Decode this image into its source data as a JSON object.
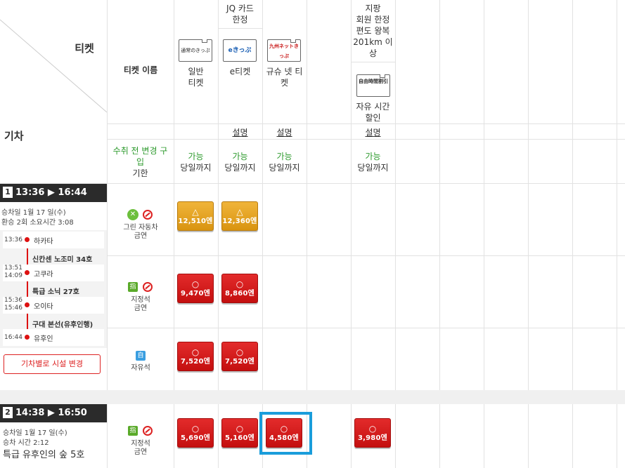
{
  "header": {
    "ticket_label": "티켓",
    "train_label": "기차",
    "ticket_name_label": "티켓 이름",
    "change_limit": {
      "line1": "수취 전 변경 구",
      "line2": "입",
      "line3": "기한"
    },
    "jq_card_limited": {
      "line1": "JQ 카드",
      "line2": "한정"
    },
    "local_member": {
      "line1": "지팡",
      "line2": "회원 한정",
      "line3": "편도 왕복",
      "line4": "201km 이",
      "line5": "상"
    }
  },
  "tickets": [
    {
      "logo": "通常のきっぷ",
      "name1": "일반",
      "name2": "티켓",
      "explain": "",
      "available": "가능",
      "until": "당일까지"
    },
    {
      "logo": "eきっぷ",
      "name1": "e티켓",
      "name2": "",
      "explain": "설명",
      "available": "가능",
      "until": "당일까지"
    },
    {
      "logo": "九州ネットきっぷ",
      "name1": "규슈 넷 티",
      "name2": "켓",
      "explain": "설명",
      "available": "가능",
      "until": "당일까지"
    },
    {
      "logo": "自由時間割引",
      "name1": "자유 시간",
      "name2": "할인",
      "explain": "설명",
      "available": "가능",
      "until": "당일까지"
    }
  ],
  "train1": {
    "num": "1",
    "time": "13:36 ▶ 16:44",
    "date": "승차일 1월 17 일(수)",
    "transfer": "환승 2회  소요시간 3:08",
    "stops": [
      {
        "time": "13:36",
        "name": "하카타"
      },
      {
        "time": "13:51",
        "time2": "14:09",
        "name": "고쿠라"
      },
      {
        "time": "15:36",
        "time2": "15:46",
        "name": "오이타"
      },
      {
        "time": "16:44",
        "name": "유후인"
      }
    ],
    "segments": [
      "신칸센 노조미 34호",
      "특급 소닉 27호",
      "구대 본선(유후인행)"
    ],
    "change_btn": "기차별로 시설 변경",
    "rows": [
      {
        "seat": "그린 자동차",
        "seat2": "금연",
        "prices": [
          {
            "mark": "△",
            "amt": "12,510엔"
          },
          {
            "mark": "△",
            "amt": "12,360엔"
          }
        ]
      },
      {
        "seat": "지정석",
        "seat2": "금연",
        "prices": [
          {
            "mark": "○",
            "amt": "9,470엔"
          },
          {
            "mark": "○",
            "amt": "8,860엔"
          }
        ]
      },
      {
        "seat": "자유석",
        "seat2": "",
        "prices": [
          {
            "mark": "○",
            "amt": "7,520엔"
          },
          {
            "mark": "○",
            "amt": "7,520엔"
          }
        ]
      }
    ]
  },
  "train2": {
    "num": "2",
    "time": "14:38 ▶ 16:50",
    "date": "승차일 1월 17 일(수)",
    "duration": "승차 시간 2:12",
    "name": "특급 유후인의 숲 5호",
    "seat": "지정석",
    "seat2": "금연",
    "prices": [
      {
        "mark": "○",
        "amt": "5,690엔"
      },
      {
        "mark": "○",
        "amt": "5,160엔"
      },
      {
        "mark": "○",
        "amt": "4,580엔"
      },
      {
        "mark": "○",
        "amt": "3,980엔"
      }
    ]
  },
  "icons": {
    "green_car": "clover-icon",
    "reserved": "指",
    "free": "自",
    "no_smoking": "no-smoking-icon"
  },
  "colors": {
    "accent": "#d11",
    "highlight": "#1a9ddb",
    "green": "#2d9a2d"
  }
}
